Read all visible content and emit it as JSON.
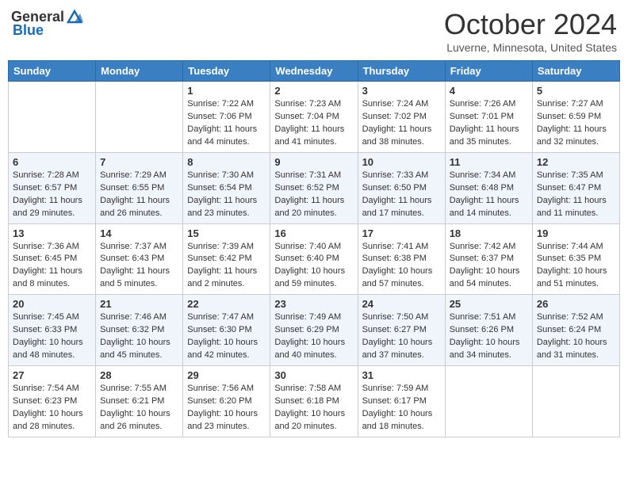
{
  "header": {
    "logo_general": "General",
    "logo_blue": "Blue",
    "title": "October 2024",
    "location": "Luverne, Minnesota, United States"
  },
  "weekdays": [
    "Sunday",
    "Monday",
    "Tuesday",
    "Wednesday",
    "Thursday",
    "Friday",
    "Saturday"
  ],
  "weeks": [
    [
      {
        "day": "",
        "sunrise": "",
        "sunset": "",
        "daylight": ""
      },
      {
        "day": "",
        "sunrise": "",
        "sunset": "",
        "daylight": ""
      },
      {
        "day": "1",
        "sunrise": "Sunrise: 7:22 AM",
        "sunset": "Sunset: 7:06 PM",
        "daylight": "Daylight: 11 hours and 44 minutes."
      },
      {
        "day": "2",
        "sunrise": "Sunrise: 7:23 AM",
        "sunset": "Sunset: 7:04 PM",
        "daylight": "Daylight: 11 hours and 41 minutes."
      },
      {
        "day": "3",
        "sunrise": "Sunrise: 7:24 AM",
        "sunset": "Sunset: 7:02 PM",
        "daylight": "Daylight: 11 hours and 38 minutes."
      },
      {
        "day": "4",
        "sunrise": "Sunrise: 7:26 AM",
        "sunset": "Sunset: 7:01 PM",
        "daylight": "Daylight: 11 hours and 35 minutes."
      },
      {
        "day": "5",
        "sunrise": "Sunrise: 7:27 AM",
        "sunset": "Sunset: 6:59 PM",
        "daylight": "Daylight: 11 hours and 32 minutes."
      }
    ],
    [
      {
        "day": "6",
        "sunrise": "Sunrise: 7:28 AM",
        "sunset": "Sunset: 6:57 PM",
        "daylight": "Daylight: 11 hours and 29 minutes."
      },
      {
        "day": "7",
        "sunrise": "Sunrise: 7:29 AM",
        "sunset": "Sunset: 6:55 PM",
        "daylight": "Daylight: 11 hours and 26 minutes."
      },
      {
        "day": "8",
        "sunrise": "Sunrise: 7:30 AM",
        "sunset": "Sunset: 6:54 PM",
        "daylight": "Daylight: 11 hours and 23 minutes."
      },
      {
        "day": "9",
        "sunrise": "Sunrise: 7:31 AM",
        "sunset": "Sunset: 6:52 PM",
        "daylight": "Daylight: 11 hours and 20 minutes."
      },
      {
        "day": "10",
        "sunrise": "Sunrise: 7:33 AM",
        "sunset": "Sunset: 6:50 PM",
        "daylight": "Daylight: 11 hours and 17 minutes."
      },
      {
        "day": "11",
        "sunrise": "Sunrise: 7:34 AM",
        "sunset": "Sunset: 6:48 PM",
        "daylight": "Daylight: 11 hours and 14 minutes."
      },
      {
        "day": "12",
        "sunrise": "Sunrise: 7:35 AM",
        "sunset": "Sunset: 6:47 PM",
        "daylight": "Daylight: 11 hours and 11 minutes."
      }
    ],
    [
      {
        "day": "13",
        "sunrise": "Sunrise: 7:36 AM",
        "sunset": "Sunset: 6:45 PM",
        "daylight": "Daylight: 11 hours and 8 minutes."
      },
      {
        "day": "14",
        "sunrise": "Sunrise: 7:37 AM",
        "sunset": "Sunset: 6:43 PM",
        "daylight": "Daylight: 11 hours and 5 minutes."
      },
      {
        "day": "15",
        "sunrise": "Sunrise: 7:39 AM",
        "sunset": "Sunset: 6:42 PM",
        "daylight": "Daylight: 11 hours and 2 minutes."
      },
      {
        "day": "16",
        "sunrise": "Sunrise: 7:40 AM",
        "sunset": "Sunset: 6:40 PM",
        "daylight": "Daylight: 10 hours and 59 minutes."
      },
      {
        "day": "17",
        "sunrise": "Sunrise: 7:41 AM",
        "sunset": "Sunset: 6:38 PM",
        "daylight": "Daylight: 10 hours and 57 minutes."
      },
      {
        "day": "18",
        "sunrise": "Sunrise: 7:42 AM",
        "sunset": "Sunset: 6:37 PM",
        "daylight": "Daylight: 10 hours and 54 minutes."
      },
      {
        "day": "19",
        "sunrise": "Sunrise: 7:44 AM",
        "sunset": "Sunset: 6:35 PM",
        "daylight": "Daylight: 10 hours and 51 minutes."
      }
    ],
    [
      {
        "day": "20",
        "sunrise": "Sunrise: 7:45 AM",
        "sunset": "Sunset: 6:33 PM",
        "daylight": "Daylight: 10 hours and 48 minutes."
      },
      {
        "day": "21",
        "sunrise": "Sunrise: 7:46 AM",
        "sunset": "Sunset: 6:32 PM",
        "daylight": "Daylight: 10 hours and 45 minutes."
      },
      {
        "day": "22",
        "sunrise": "Sunrise: 7:47 AM",
        "sunset": "Sunset: 6:30 PM",
        "daylight": "Daylight: 10 hours and 42 minutes."
      },
      {
        "day": "23",
        "sunrise": "Sunrise: 7:49 AM",
        "sunset": "Sunset: 6:29 PM",
        "daylight": "Daylight: 10 hours and 40 minutes."
      },
      {
        "day": "24",
        "sunrise": "Sunrise: 7:50 AM",
        "sunset": "Sunset: 6:27 PM",
        "daylight": "Daylight: 10 hours and 37 minutes."
      },
      {
        "day": "25",
        "sunrise": "Sunrise: 7:51 AM",
        "sunset": "Sunset: 6:26 PM",
        "daylight": "Daylight: 10 hours and 34 minutes."
      },
      {
        "day": "26",
        "sunrise": "Sunrise: 7:52 AM",
        "sunset": "Sunset: 6:24 PM",
        "daylight": "Daylight: 10 hours and 31 minutes."
      }
    ],
    [
      {
        "day": "27",
        "sunrise": "Sunrise: 7:54 AM",
        "sunset": "Sunset: 6:23 PM",
        "daylight": "Daylight: 10 hours and 28 minutes."
      },
      {
        "day": "28",
        "sunrise": "Sunrise: 7:55 AM",
        "sunset": "Sunset: 6:21 PM",
        "daylight": "Daylight: 10 hours and 26 minutes."
      },
      {
        "day": "29",
        "sunrise": "Sunrise: 7:56 AM",
        "sunset": "Sunset: 6:20 PM",
        "daylight": "Daylight: 10 hours and 23 minutes."
      },
      {
        "day": "30",
        "sunrise": "Sunrise: 7:58 AM",
        "sunset": "Sunset: 6:18 PM",
        "daylight": "Daylight: 10 hours and 20 minutes."
      },
      {
        "day": "31",
        "sunrise": "Sunrise: 7:59 AM",
        "sunset": "Sunset: 6:17 PM",
        "daylight": "Daylight: 10 hours and 18 minutes."
      },
      {
        "day": "",
        "sunrise": "",
        "sunset": "",
        "daylight": ""
      },
      {
        "day": "",
        "sunrise": "",
        "sunset": "",
        "daylight": ""
      }
    ]
  ]
}
